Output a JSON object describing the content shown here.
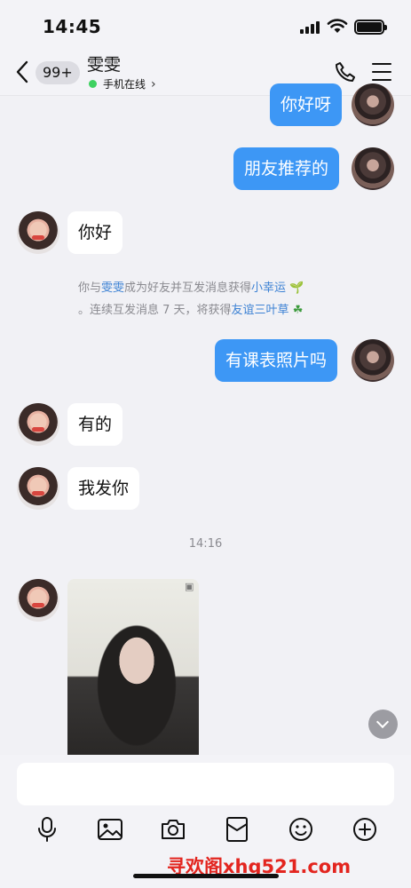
{
  "status_bar": {
    "time": "14:45"
  },
  "header": {
    "unread_badge": "99+",
    "contact_name": "雯雯",
    "status_text": "手机在线",
    "status_chevron": "›"
  },
  "messages": [
    {
      "dir": "out",
      "text": "你好呀"
    },
    {
      "dir": "out",
      "text": "朋友推荐的"
    },
    {
      "dir": "in",
      "text": "你好"
    },
    {
      "dir": "out",
      "text": "有课表照片吗"
    },
    {
      "dir": "in",
      "text": "有的"
    },
    {
      "dir": "in",
      "text": "我发你"
    }
  ],
  "system_notice": {
    "p1": "你与",
    "name": "雯雯",
    "p2": "成为好友并互发消息获得",
    "badge1": "小幸运",
    "icon1": "🌱",
    "p3": "。连续互发消息 7 天，将获得",
    "badge2": "友谊三叶草",
    "icon2": "☘"
  },
  "timestamp": "14:16",
  "photo_message": {
    "sender": "in",
    "icon": "photo-icon"
  },
  "input": {
    "placeholder": ""
  },
  "toolbar": [
    "microphone-icon",
    "image-icon",
    "camera-icon",
    "red-packet-icon",
    "emoji-icon",
    "plus-icon"
  ],
  "watermark": "寻欢阁xhg521.com"
}
